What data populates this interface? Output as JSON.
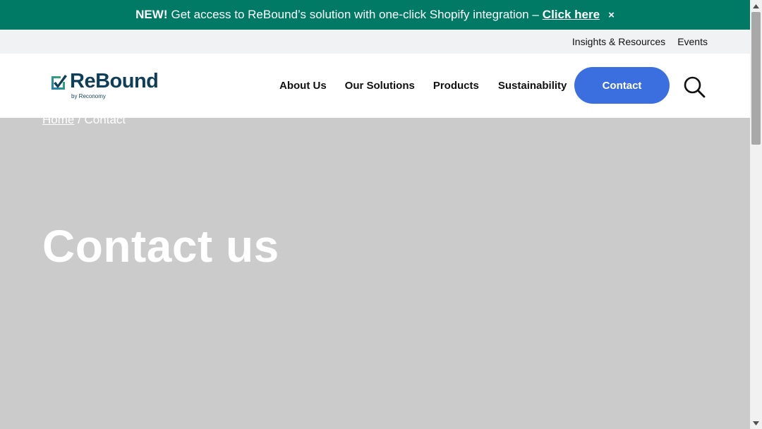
{
  "announcement": {
    "new_label": "NEW!",
    "text": "Get access to ReBound’s solution with one-click Shopify integration –",
    "link_label": "Click here",
    "close_glyph": "×"
  },
  "utility_nav": {
    "items": [
      "Insights & Resources",
      "Events"
    ]
  },
  "logo": {
    "word": "ReBound",
    "sub": "by Reconomy"
  },
  "nav": {
    "items": [
      "About Us",
      "Our Solutions",
      "Products",
      "Sustainability"
    ]
  },
  "header": {
    "contact_label": "Contact",
    "search_icon": "search-icon"
  },
  "breadcrumb": {
    "home": "Home",
    "separator": " / ",
    "current": "Contact"
  },
  "hero": {
    "title": "Contact us"
  },
  "colors": {
    "announcement_bg": "#007a64",
    "accent": "#3b6fe0",
    "brand": "#0f3f58",
    "hero_bg": "#cbcbcb"
  }
}
